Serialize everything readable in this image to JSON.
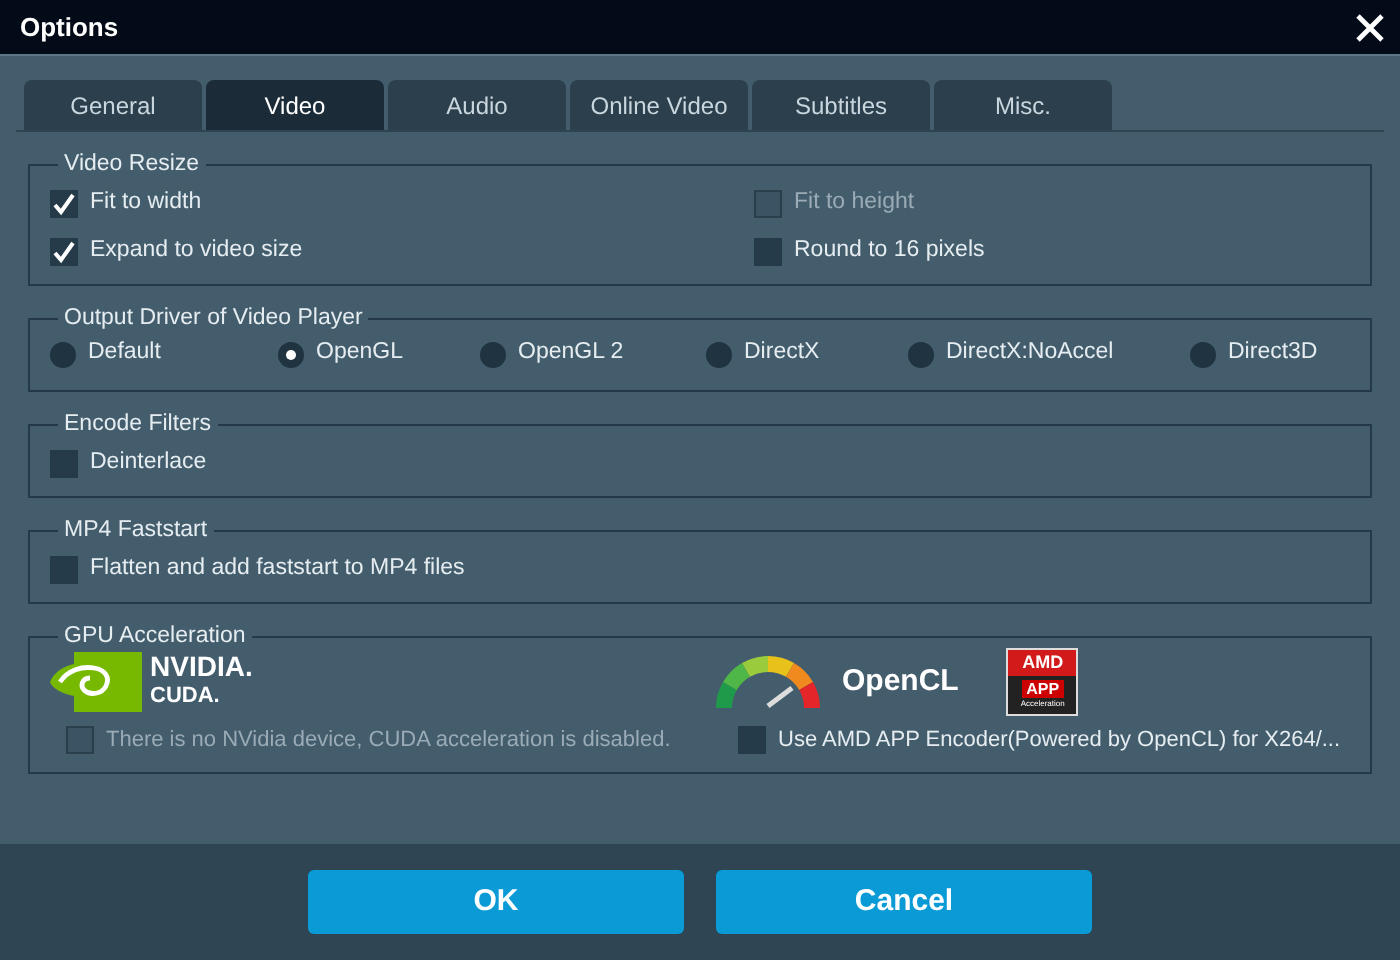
{
  "window": {
    "title": "Options"
  },
  "tabs": [
    {
      "label": "General",
      "selected": false
    },
    {
      "label": "Video",
      "selected": true
    },
    {
      "label": "Audio",
      "selected": false
    },
    {
      "label": "Online Video",
      "selected": false
    },
    {
      "label": "Subtitles",
      "selected": false
    },
    {
      "label": "Misc.",
      "selected": false
    }
  ],
  "sections": [
    {
      "kind": "checks",
      "title": "Video Resize",
      "options": [
        {
          "label": "Fit to width",
          "checked": true,
          "disabled": false
        },
        {
          "label": "Fit to height",
          "checked": false,
          "disabled": true
        },
        {
          "label": "Expand to video size",
          "checked": true,
          "disabled": false
        },
        {
          "label": "Round to 16 pixels",
          "checked": false,
          "disabled": false
        }
      ]
    },
    {
      "kind": "radios",
      "title": "Output Driver of Video Player",
      "options": [
        {
          "label": "Default",
          "selected": false
        },
        {
          "label": "OpenGL",
          "selected": true
        },
        {
          "label": "OpenGL 2",
          "selected": false
        },
        {
          "label": "DirectX",
          "selected": false
        },
        {
          "label": "DirectX:NoAccel",
          "selected": false
        },
        {
          "label": "Direct3D",
          "selected": false
        }
      ]
    },
    {
      "kind": "checks",
      "title": "Encode Filters",
      "options": [
        {
          "label": "Deinterlace",
          "checked": false,
          "disabled": false
        }
      ]
    },
    {
      "kind": "checks",
      "title": "MP4 Faststart",
      "options": [
        {
          "label": "Flatten and add faststart to MP4 files",
          "checked": false,
          "disabled": false
        }
      ]
    },
    {
      "kind": "gpu",
      "title": "GPU Acceleration",
      "nvidia_logo": {
        "line_1": "NVIDIA.",
        "line_2": "CUDA."
      },
      "opencl_logo": {
        "text": "OpenCL"
      },
      "amd_logo": {
        "brand": "AMD",
        "product": "APP",
        "caption": "Acceleration"
      },
      "options": [
        {
          "label": "There is no NVidia device, CUDA acceleration is disabled.",
          "checked": false,
          "disabled": true
        },
        {
          "label": "Use AMD APP Encoder(Powered by OpenCL) for X264/...",
          "checked": false,
          "disabled": false
        }
      ]
    }
  ],
  "buttons": [
    "OK",
    "Cancel"
  ]
}
